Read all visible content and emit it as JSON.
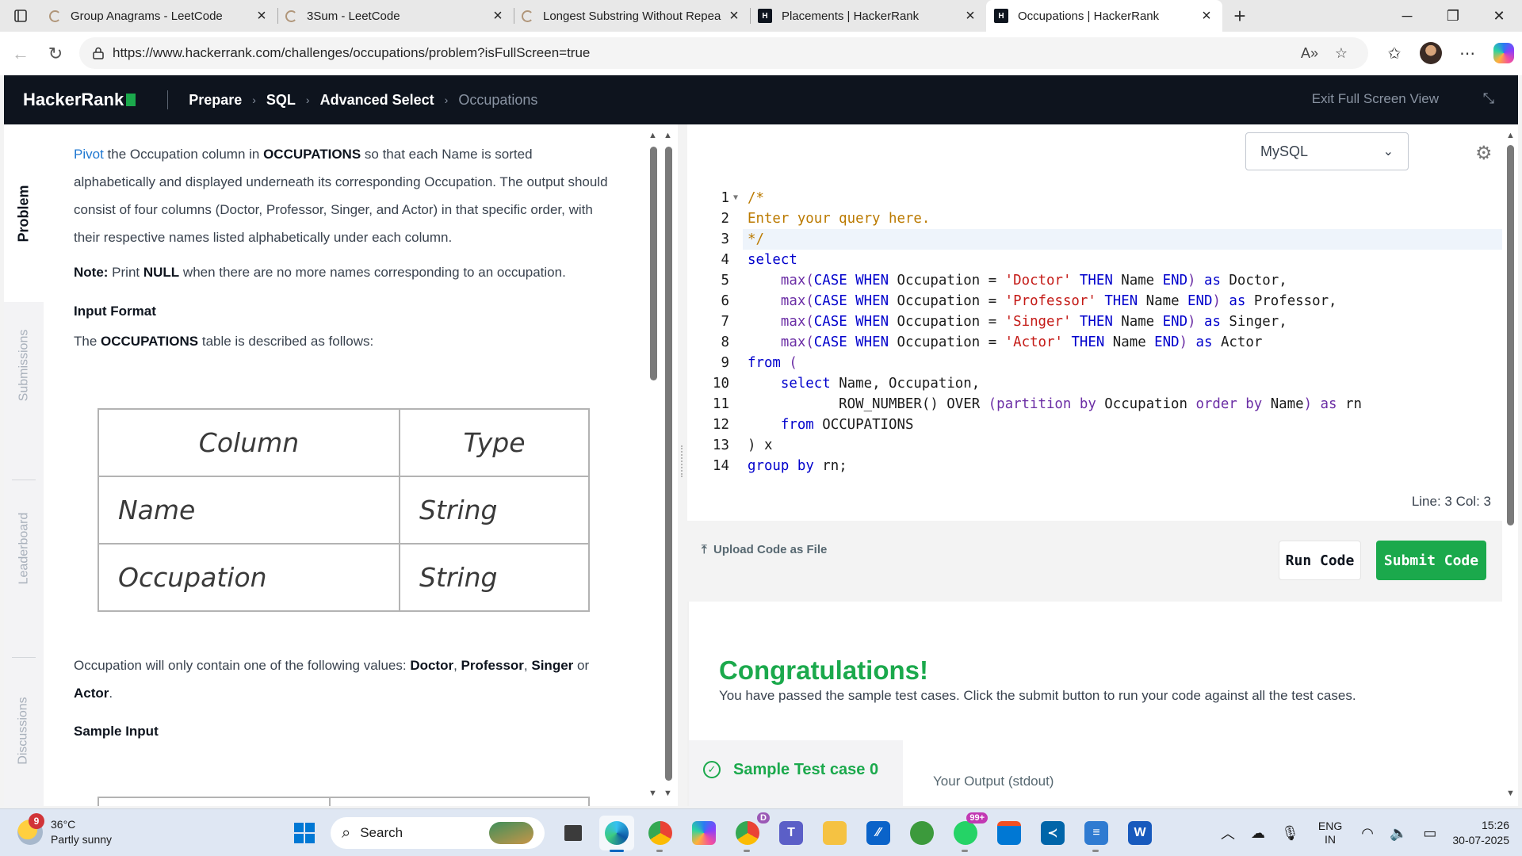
{
  "browser": {
    "tabs": [
      {
        "title": "Group Anagrams - LeetCode",
        "favicon": "leetcode-icon",
        "active": false
      },
      {
        "title": "3Sum - LeetCode",
        "favicon": "leetcode-icon",
        "active": false
      },
      {
        "title": "Longest Substring Without Repea",
        "favicon": "leetcode-icon",
        "active": false
      },
      {
        "title": "Placements | HackerRank",
        "favicon": "hackerrank-icon",
        "active": false
      },
      {
        "title": "Occupations | HackerRank",
        "favicon": "hackerrank-icon",
        "active": true
      }
    ],
    "favicon_hr_glyph": "H",
    "url": "https://www.hackerrank.com/challenges/occupations/problem?isFullScreen=true"
  },
  "hr_header": {
    "logo": "HackerRank",
    "breadcrumbs": [
      "Prepare",
      "SQL",
      "Advanced Select",
      "Occupations"
    ],
    "exit_fullscreen": "Exit Full Screen View"
  },
  "side_tabs": {
    "problem": "Problem",
    "submissions": "Submissions",
    "leaderboard": "Leaderboard",
    "discussions": "Discussions"
  },
  "problem": {
    "intro": {
      "link": "Pivot",
      "t1": " the Occupation column in ",
      "b1": "OCCUPATIONS",
      "t2": " so that each Name is sorted alphabetically and displayed underneath its corresponding Occupation. The output should consist of four columns (Doctor, Professor, Singer, and Actor) in that specific order, with their respective names listed alphabetically under each column."
    },
    "note": {
      "label": "Note:",
      "t1": " Print ",
      "b1": "NULL",
      "t2": " when there are no more names corresponding to an occupation."
    },
    "input_format_heading": "Input Format",
    "table_desc": {
      "t1": "The ",
      "b1": "OCCUPATIONS",
      "t2": " table is described as follows:"
    },
    "schema_table": {
      "headers": [
        "Column",
        "Type"
      ],
      "rows": [
        [
          "Name",
          "String"
        ],
        [
          "Occupation",
          "String"
        ]
      ]
    },
    "values_line": {
      "t1": "Occupation will only contain one of the following values: ",
      "v1": "Doctor",
      "c1": ", ",
      "v2": "Professor",
      "c2": ", ",
      "v3": "Singer",
      "t2": " or ",
      "v4": "Actor",
      "t3": "."
    },
    "sample_input_heading": "Sample Input"
  },
  "editor": {
    "language": "MySQL",
    "line_numbers": [
      "1",
      "2",
      "3",
      "4",
      "5",
      "6",
      "7",
      "8",
      "9",
      "10",
      "11",
      "12",
      "13",
      "14"
    ],
    "cursor_status": "Line: 3 Col: 3",
    "code": {
      "l1": "/*",
      "l2": "Enter your query here.",
      "l3": "*/",
      "l4": "select",
      "l5": [
        "    ",
        "max",
        "(",
        "CASE",
        " ",
        "WHEN",
        " Occupation = ",
        "'Doctor'",
        " ",
        "THEN",
        " Name ",
        "END",
        ") ",
        "as",
        " Doctor,"
      ],
      "l6": [
        "    ",
        "max",
        "(",
        "CASE",
        " ",
        "WHEN",
        " Occupation = ",
        "'Professor'",
        " ",
        "THEN",
        " Name ",
        "END",
        ") ",
        "as",
        " Professor,"
      ],
      "l7": [
        "    ",
        "max",
        "(",
        "CASE",
        " ",
        "WHEN",
        " Occupation = ",
        "'Singer'",
        " ",
        "THEN",
        " Name ",
        "END",
        ") ",
        "as",
        " Singer,"
      ],
      "l8": [
        "    ",
        "max",
        "(",
        "CASE",
        " ",
        "WHEN",
        " Occupation = ",
        "'Actor'",
        " ",
        "THEN",
        " Name ",
        "END",
        ") ",
        "as",
        " Actor"
      ],
      "l9": [
        "from",
        " ("
      ],
      "l10": [
        "    ",
        "select",
        " Name, Occupation,"
      ],
      "l11": [
        "           ",
        "ROW_NUMBER",
        "() OVER ",
        "(",
        "partition",
        " ",
        "by",
        " Occupation ",
        "order",
        " ",
        "by",
        " Name",
        ") ",
        "as",
        " rn"
      ],
      "l12": [
        "    ",
        "from",
        " OCCUPATIONS"
      ],
      "l13": [
        ") x"
      ],
      "l14": [
        "group",
        " ",
        "by",
        " rn;"
      ]
    }
  },
  "actions": {
    "upload": "Upload Code as File",
    "run": "Run Code",
    "submit": "Submit Code"
  },
  "results": {
    "title": "Congratulations!",
    "message": "You have passed the sample test cases. Click the submit button to run your code against all the test cases.",
    "test_case": "Sample Test case 0",
    "output_label": "Your Output (stdout)"
  },
  "taskbar": {
    "temperature": "36°C",
    "weather": "Partly sunny",
    "weather_badge": "9",
    "search": "Search",
    "whatsapp_badge": "99+",
    "chrome_profile_badge": "D",
    "lang_line1": "ENG",
    "lang_line2": "IN",
    "time": "15:26",
    "date": "30-07-2025"
  },
  "colors": {
    "hr_dark": "#0e141e",
    "hr_green": "#1ba94c",
    "link_blue": "#1f78d1"
  }
}
